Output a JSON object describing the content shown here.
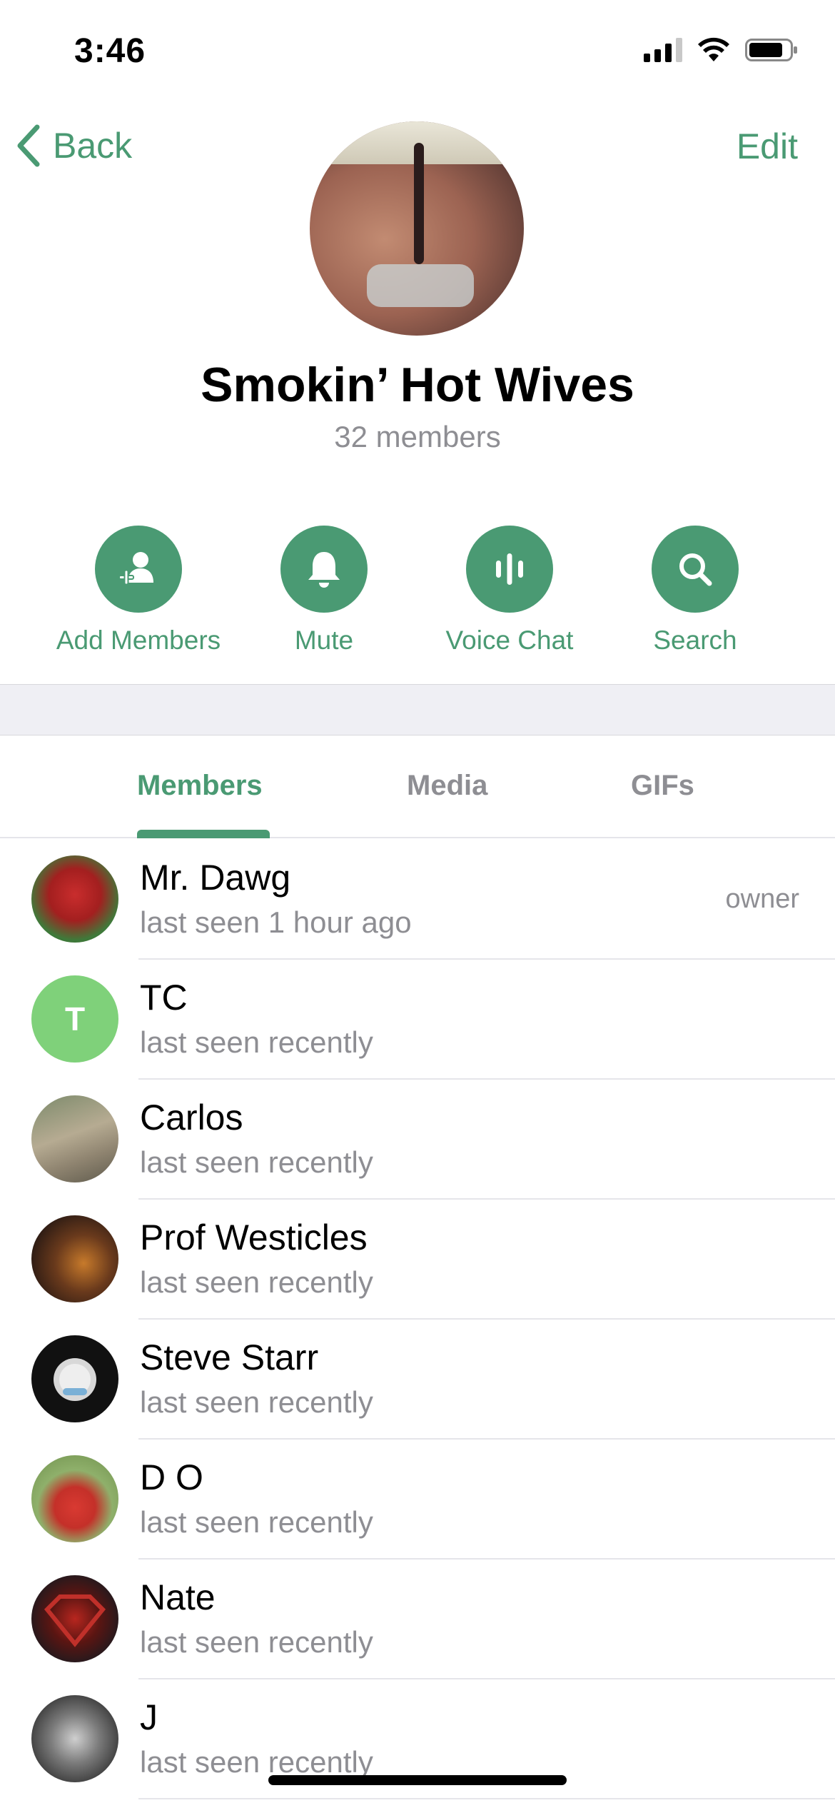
{
  "status_bar": {
    "time": "3:46"
  },
  "header": {
    "back_label": "Back",
    "edit_label": "Edit"
  },
  "group": {
    "title": "Smokin’ Hot Wives",
    "subtitle": "32 members"
  },
  "actions": [
    {
      "label": "Add Members",
      "icon": "add-member-icon"
    },
    {
      "label": "Mute",
      "icon": "bell-icon"
    },
    {
      "label": "Voice Chat",
      "icon": "voice-wave-icon"
    },
    {
      "label": "Search",
      "icon": "search-icon"
    }
  ],
  "tabs": [
    {
      "label": "Members",
      "active": true
    },
    {
      "label": "Media",
      "active": false
    },
    {
      "label": "GIFs",
      "active": false
    }
  ],
  "members": [
    {
      "name": "Mr. Dawg",
      "status": "last seen 1 hour ago",
      "role": "owner"
    },
    {
      "name": "TC",
      "status": "last seen recently",
      "initial": "T"
    },
    {
      "name": "Carlos",
      "status": "last seen recently"
    },
    {
      "name": "Prof Westicles",
      "status": "last seen recently"
    },
    {
      "name": "Steve Starr",
      "status": "last seen recently"
    },
    {
      "name": "D O",
      "status": "last seen recently"
    },
    {
      "name": "Nate",
      "status": "last seen recently"
    },
    {
      "name": "J",
      "status": "last seen recently"
    }
  ],
  "colors": {
    "accent": "#4a9a73",
    "secondary_text": "#8e8e93",
    "separator": "#efeff4"
  }
}
